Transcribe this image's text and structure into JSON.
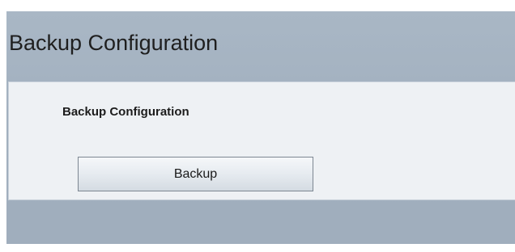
{
  "page": {
    "title": "Backup Configuration"
  },
  "section": {
    "title": "Backup Configuration",
    "backup_button_label": "Backup"
  }
}
